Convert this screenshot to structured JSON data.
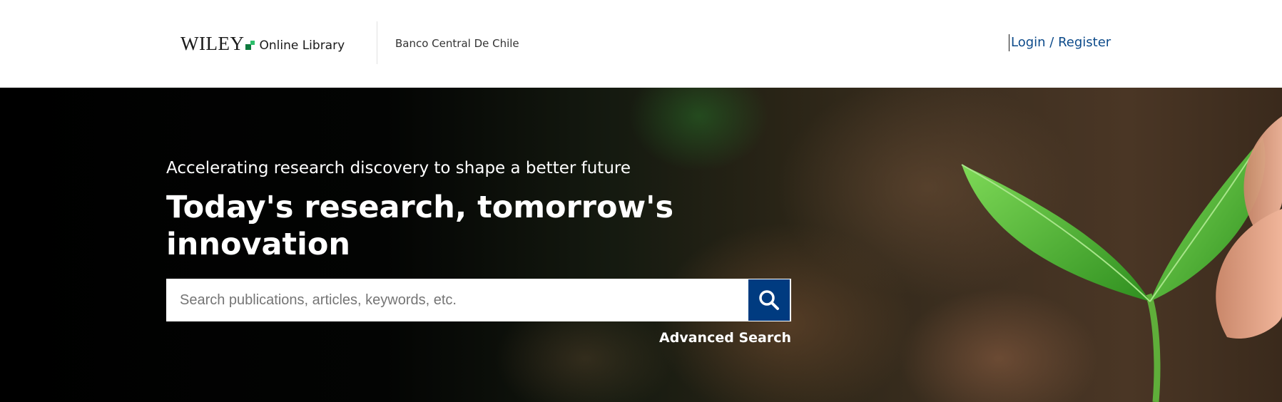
{
  "header": {
    "logo": {
      "brand": "WILEY",
      "product": "Online Library"
    },
    "institution": "Banco Central De Chile",
    "login_label": "Login / Register"
  },
  "hero": {
    "tagline": "Accelerating research discovery to shape a better future",
    "headline": "Today's research, tomorrow's innovation",
    "search": {
      "placeholder": "Search publications, articles, keywords, etc.",
      "value": "",
      "button_icon": "search-icon"
    },
    "advanced_search_label": "Advanced Search"
  },
  "colors": {
    "brand_blue": "#003b80",
    "link_blue": "#0c4a8a",
    "logo_green": "#0d7a3e",
    "text_white": "#ffffff"
  }
}
